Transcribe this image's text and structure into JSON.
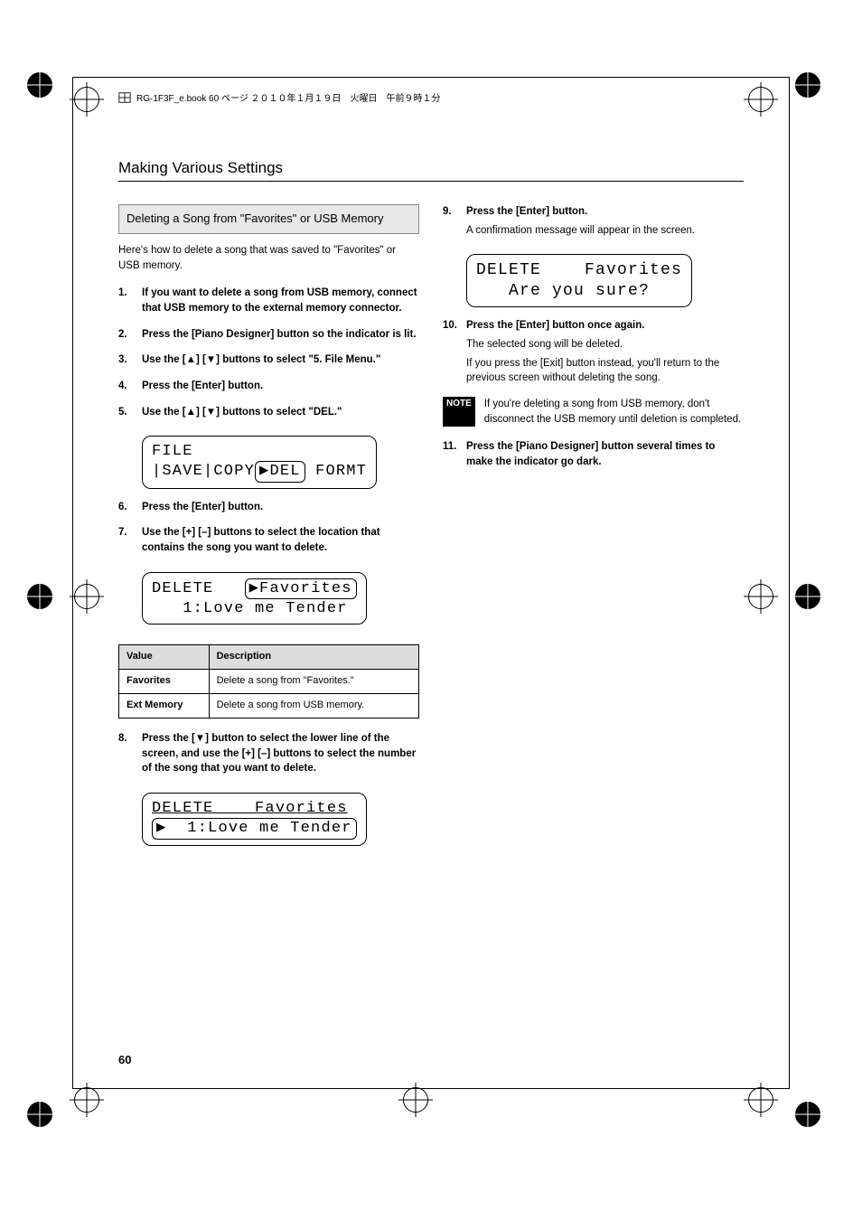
{
  "header": {
    "text": "RG-1F3F_e.book  60 ページ  ２０１０年１月１９日　火曜日　午前９時１分"
  },
  "chapter": "Making Various Settings",
  "section_heading": "Deleting a Song from \"Favorites\" or USB Memory",
  "intro": "Here's how to delete a song that was saved to \"Favorites\" or USB memory.",
  "steps_left_a": [
    "If you want to delete a song from USB memory, connect that USB memory to the external memory connector.",
    "Press the [Piano Designer] button so the indicator is lit.",
    "Use the [▲] [▼] buttons to select \"5. File Menu.\"",
    "Press the [Enter] button.",
    "Use the [▲] [▼] buttons to select \"DEL.\""
  ],
  "lcd1_line1": "FILE",
  "lcd1_line2_a": "|SAVE|COPY",
  "lcd1_line2_b": "▶DEL",
  "lcd1_line2_c": " FORMT",
  "steps_left_b": [
    "Press the [Enter] button.",
    "Use the [+] [–] buttons to select the location that contains the song you want to delete."
  ],
  "lcd2_line1_a": "DELETE   ",
  "lcd2_line1_b": "▶Favorites",
  "lcd2_line2": "   1:Love me Tender",
  "table": {
    "headers": [
      "Value",
      "Description"
    ],
    "rows": [
      [
        "Favorites",
        "Delete a song from \"Favorites.\""
      ],
      [
        "Ext Memory",
        "Delete a song from USB memory."
      ]
    ]
  },
  "step8": "Press the [▼] button to select the lower line of the screen, and use the [+] [–] buttons to select the number of the song that you want to delete.",
  "lcd3_line1": "DELETE    Favorites",
  "lcd3_line2": "▶  1:Love me Tender",
  "step9": "Press the [Enter] button.",
  "step9_body": "A confirmation message will appear in the screen.",
  "lcd4_line1": "DELETE    Favorites",
  "lcd4_line2": "   Are you sure?",
  "step10": "Press the [Enter] button once again.",
  "step10_body1": "The selected song will be deleted.",
  "step10_body2": "If you press the [Exit] button instead, you'll return to the previous screen without deleting the song.",
  "note_label": "NOTE",
  "note_text": "If you're deleting a song from USB memory, don't disconnect the USB memory until deletion is completed.",
  "step11": "Press the [Piano Designer] button several times to make the indicator go dark.",
  "page_number": "60"
}
